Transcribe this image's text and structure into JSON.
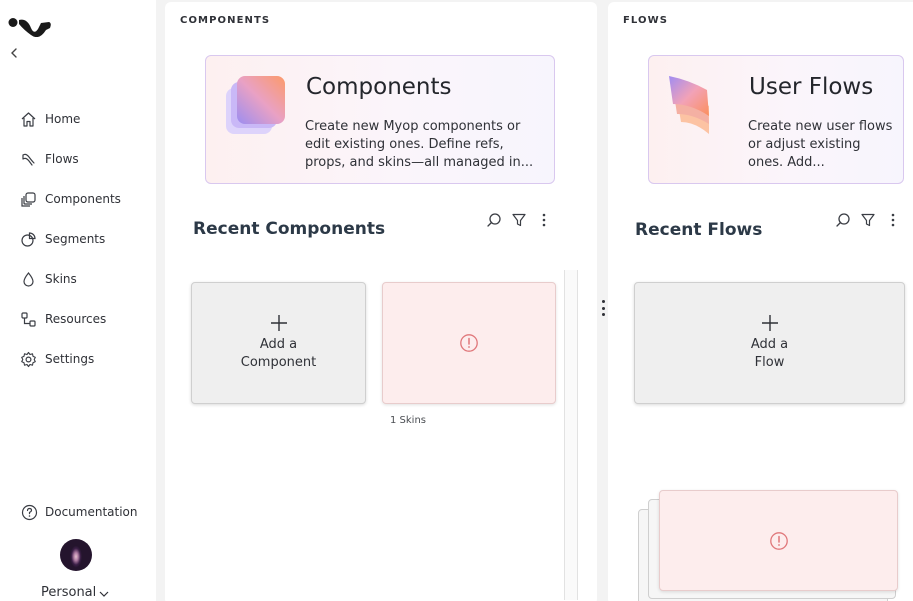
{
  "sidebar": {
    "nav": [
      {
        "label": "Home",
        "icon": "home-icon"
      },
      {
        "label": "Flows",
        "icon": "flows-icon"
      },
      {
        "label": "Components",
        "icon": "components-icon"
      },
      {
        "label": "Segments",
        "icon": "segments-icon"
      },
      {
        "label": "Skins",
        "icon": "skins-icon"
      },
      {
        "label": "Resources",
        "icon": "resources-icon"
      },
      {
        "label": "Settings",
        "icon": "gear-icon"
      }
    ],
    "documentation_label": "Documentation",
    "account_label": "Personal"
  },
  "components_panel": {
    "header": "COMPONENTS",
    "hero_title": "Components",
    "hero_desc": "Create new Myop components or edit existing ones. Define refs, props, and skins—all managed in...",
    "section_title": "Recent Components",
    "add_card_line1": "Add a",
    "add_card_line2": "Component",
    "skins_count": "1 Skins"
  },
  "flows_panel": {
    "header": "FLOWS",
    "hero_title": "User Flows",
    "hero_desc": "Create new user flows or adjust existing ones. Add...",
    "section_title": "Recent Flows",
    "add_card_line1": "Add a",
    "add_card_line2": "Flow"
  },
  "colors": {
    "error": "#e0777a",
    "hero_border": "#d9c8ef",
    "heading": "#2c3947"
  }
}
